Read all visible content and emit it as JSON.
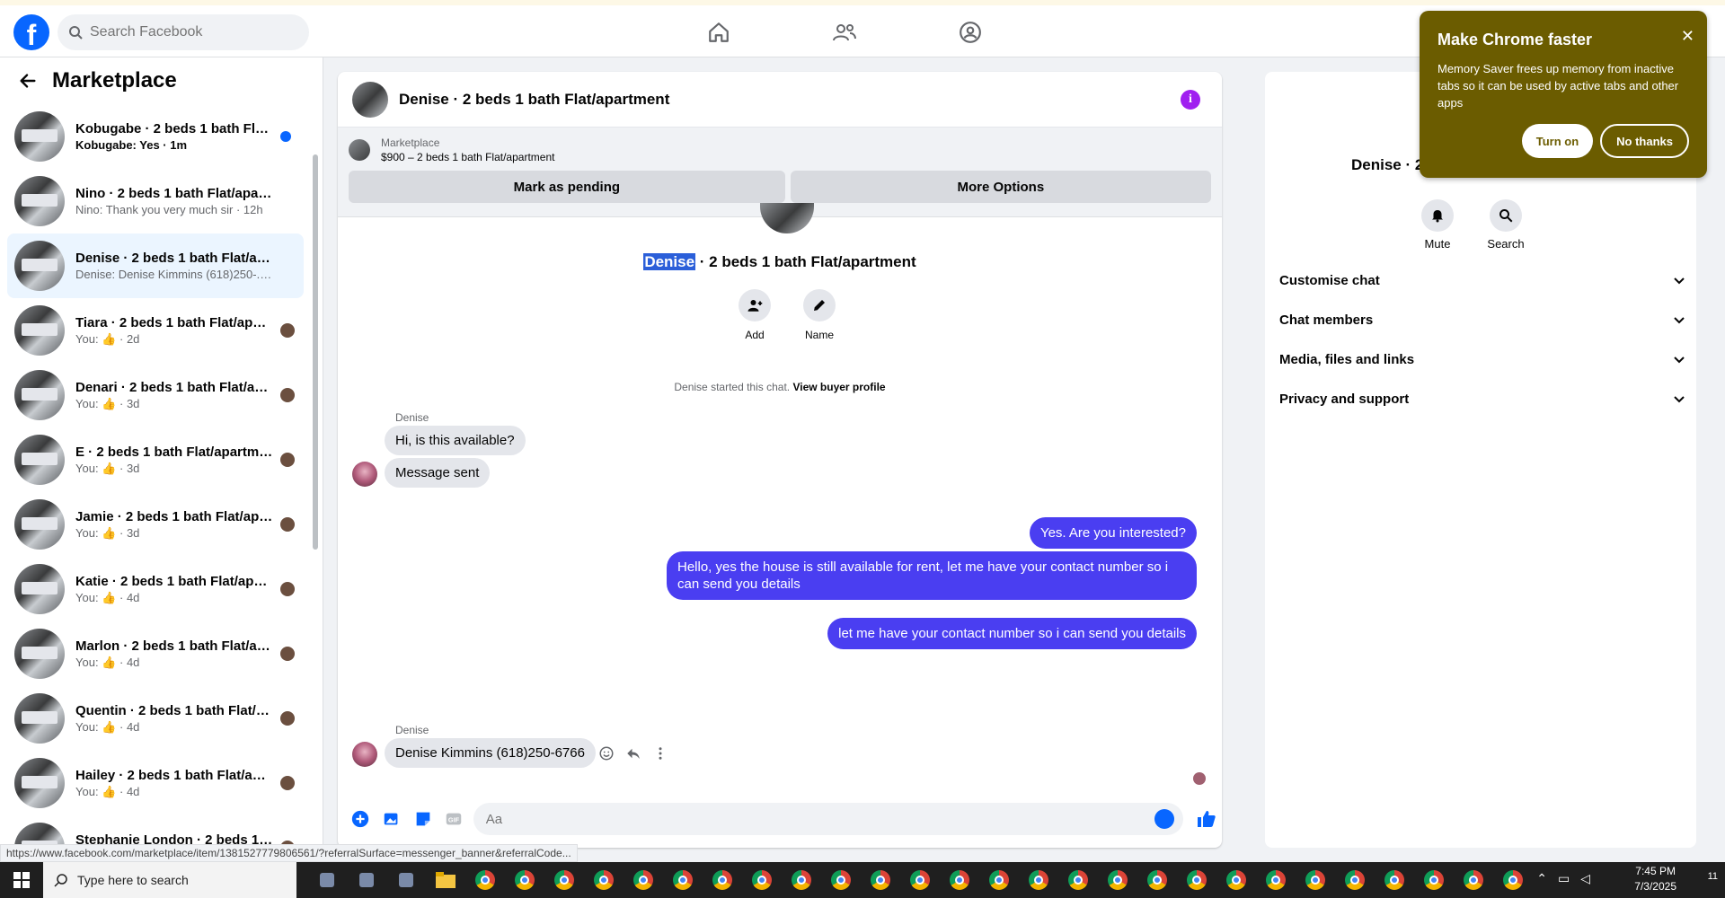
{
  "topbar": {
    "logo": "f",
    "search_placeholder": "Search Facebook"
  },
  "left": {
    "title": "Marketplace",
    "conversations": [
      {
        "title": "Kobugabe · 2 beds 1 bath Flat/...",
        "sub": "Kobugabe: Yes · 1m",
        "unread": true
      },
      {
        "title": "Nino · 2 beds 1 bath Flat/apartm...",
        "sub": "Nino: Thank you very much sir · 12h"
      },
      {
        "title": "Denise · 2 beds 1 bath Flat/apart...",
        "sub": "Denise: Denise Kimmins (618)250-... · 12h",
        "active": true
      },
      {
        "title": "Tiara · 2 beds 1 bath Flat/apar...",
        "sub_prefix": "You:",
        "sub_suffix": "· 2d"
      },
      {
        "title": "Denari · 2 beds 1 bath Flat/ap...",
        "sub_prefix": "You:",
        "sub_suffix": "· 3d"
      },
      {
        "title": "E · 2 beds 1 bath Flat/apartment",
        "sub_prefix": "You:",
        "sub_suffix": "· 3d"
      },
      {
        "title": "Jamie · 2 beds 1 bath Flat/apa...",
        "sub_prefix": "You:",
        "sub_suffix": "· 3d"
      },
      {
        "title": "Katie · 2 beds 1 bath Flat/apar...",
        "sub_prefix": "You:",
        "sub_suffix": "· 4d"
      },
      {
        "title": "Marlon · 2 beds 1 bath Flat/ap...",
        "sub_prefix": "You:",
        "sub_suffix": "· 4d"
      },
      {
        "title": "Quentin · 2 beds 1 bath Flat/a...",
        "sub_prefix": "You:",
        "sub_suffix": "· 4d"
      },
      {
        "title": "Hailey · 2 beds 1 bath Flat/apa...",
        "sub_prefix": "You:",
        "sub_suffix": "· 4d"
      },
      {
        "title": "Stephanie London · 2 beds 1 b...",
        "sub_prefix": "You:",
        "sub_suffix": "· 4d"
      }
    ]
  },
  "chat": {
    "header_name": "Denise · 2 beds 1 bath Flat/apartment",
    "info_label": "i",
    "banner_label": "Marketplace",
    "banner_listing": "$900 – 2 beds 1 bath Flat/apartment",
    "mark_pending": "Mark as pending",
    "more_options": "More Options",
    "title_highlight": "Denise",
    "title_rest": " · 2 beds 1 bath Flat/apartment",
    "add_label": "Add",
    "name_label": "Name",
    "started_text": "Denise started this chat. ",
    "view_buyer": "View buyer profile",
    "sender1": "Denise",
    "msg_in_1": "Hi, is this available?",
    "msg_in_2": "Message sent",
    "msg_out_1": "Yes. Are you interested?",
    "msg_out_2": "Hello, yes the house is still available for rent, let me have your contact number so i can send you details",
    "msg_out_3": "let me have your contact number so i can send you details",
    "sender2": "Denise",
    "msg_in_3": "Denise Kimmins (618)250-6766",
    "composer_placeholder": "Aa"
  },
  "right": {
    "name": "Denise · 2",
    "mute": "Mute",
    "search": "Search",
    "sections": [
      "Customise chat",
      "Chat members",
      "Media, files and links",
      "Privacy and support"
    ]
  },
  "popup": {
    "title": "Make Chrome faster",
    "body": "Memory Saver frees up memory from inactive tabs so it can be used by active tabs and other apps",
    "turn_on": "Turn on",
    "no_thanks": "No thanks"
  },
  "status_url": "https://www.facebook.com/marketplace/item/1381527779806561/?referralSurface=messenger_banner&referralCode...",
  "taskbar": {
    "search_text": "Type here to search",
    "time": "7:45 PM",
    "date": "7/3/2025",
    "notif_count": "11"
  },
  "colors": {
    "brand": "#0866ff",
    "outgoing": "#4a3ef1",
    "popup": "#6b5c00"
  }
}
